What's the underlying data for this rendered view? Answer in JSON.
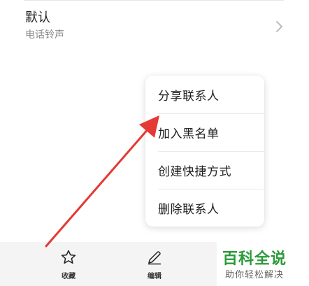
{
  "ringtone": {
    "title": "默认",
    "subtitle": "电话铃声"
  },
  "popup_menu": {
    "items": [
      {
        "label": "分享联系人"
      },
      {
        "label": "加入黑名单"
      },
      {
        "label": "创建快捷方式"
      },
      {
        "label": "删除联系人"
      }
    ]
  },
  "bottom_bar": {
    "favorite_label": "收藏",
    "edit_label": "编辑"
  },
  "watermark": {
    "title": "百科全说",
    "subtitle": "助你轻松解决"
  },
  "icons": {
    "chevron": "chevron-right-icon",
    "favorite": "star-outline-icon",
    "edit": "pencil-icon"
  },
  "colors": {
    "arrow": "#e53935",
    "watermark_green": "#2a9a38",
    "bar_background": "#f4f4f4"
  }
}
